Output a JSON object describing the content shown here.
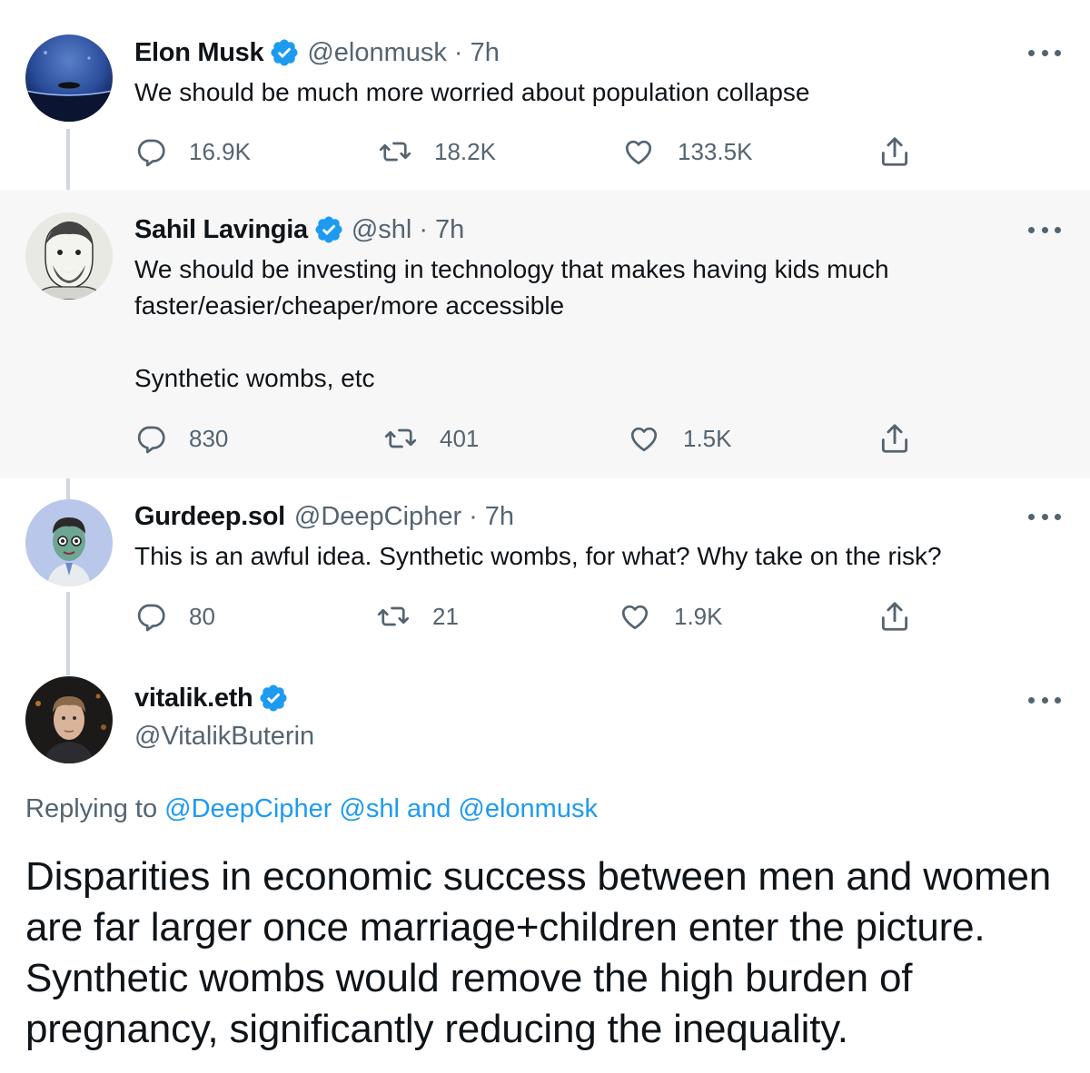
{
  "tweets": [
    {
      "name": "Elon Musk",
      "verified": true,
      "handle": "@elonmusk",
      "time": "7h",
      "text": "We should be much more worried about population collapse",
      "replies": "16.9K",
      "retweets": "18.2K",
      "likes": "133.5K"
    },
    {
      "name": "Sahil Lavingia",
      "verified": true,
      "handle": "@shl",
      "time": "7h",
      "text": "We should be investing in technology that makes having kids much\nfaster/easier/cheaper/more accessible\n\nSynthetic wombs, etc",
      "replies": "830",
      "retweets": "401",
      "likes": "1.5K"
    },
    {
      "name": "Gurdeep.sol",
      "verified": false,
      "handle": "@DeepCipher",
      "time": "7h",
      "text": "This is an awful idea. Synthetic wombs, for what? Why take on the risk?",
      "replies": "80",
      "retweets": "21",
      "likes": "1.9K"
    }
  ],
  "main_tweet": {
    "name": "vitalik.eth",
    "verified": true,
    "handle": "@VitalikButerin",
    "replying_prefix": "Replying to",
    "replying_to": "@DeepCipher @shl and @elonmusk",
    "text": "Disparities in economic success between men and women are far larger once marriage+children enter the picture. Synthetic wombs would remove the high burden of pregnancy, significantly reducing the inequality."
  },
  "separator": "·",
  "icons": {
    "reply": "reply-icon",
    "retweet": "retweet-icon",
    "like": "heart-icon",
    "share": "share-icon",
    "more": "more-icon",
    "verified": "verified-badge-icon"
  },
  "colors": {
    "text": "#0f1419",
    "secondary": "#536471",
    "link": "#1d9bf0",
    "verified": "#1d9bf0",
    "thread_line": "#cfd9de",
    "highlight_bg": "#f7f7f7"
  }
}
